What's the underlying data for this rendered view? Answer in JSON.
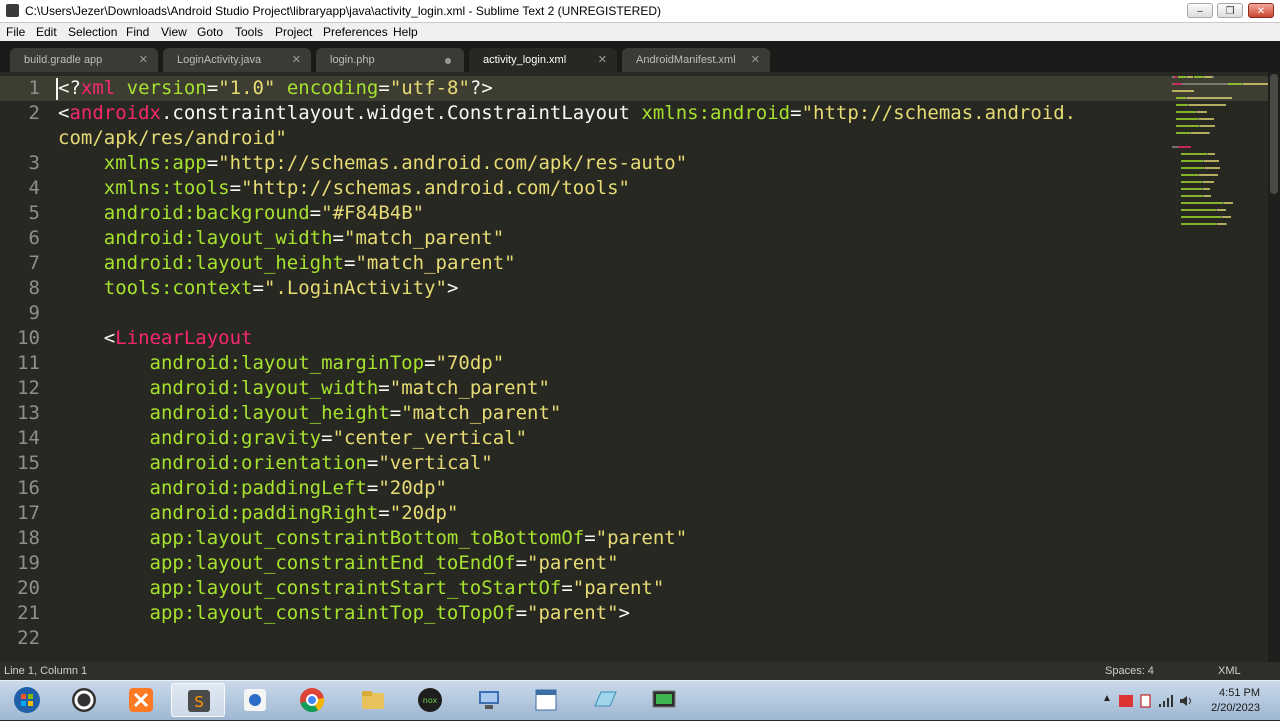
{
  "window": {
    "title": "C:\\Users\\Jezer\\Downloads\\Android Studio Project\\libraryapp\\java\\activity_login.xml - Sublime Text 2 (UNREGISTERED)",
    "controls": {
      "minimize": "–",
      "maximize": "❐",
      "close": "✕"
    }
  },
  "menu": [
    "File",
    "Edit",
    "Selection",
    "Find",
    "View",
    "Goto",
    "Tools",
    "Project",
    "Preferences",
    "Help"
  ],
  "tabs": [
    {
      "label": "build.gradle app",
      "state": "close"
    },
    {
      "label": "LoginActivity.java",
      "state": "close"
    },
    {
      "label": "login.php",
      "state": "modified"
    },
    {
      "label": "activity_login.xml",
      "state": "close",
      "active": true
    },
    {
      "label": "AndroidManifest.xml",
      "state": "close"
    }
  ],
  "code_lines": [
    {
      "n": "1",
      "tokens": [
        [
          "p",
          "<?"
        ],
        [
          "tag",
          "xml"
        ],
        [
          "p",
          " "
        ],
        [
          "attr",
          "version"
        ],
        [
          "p",
          "="
        ],
        [
          "str",
          "\"1.0\""
        ],
        [
          "p",
          " "
        ],
        [
          "attr",
          "encoding"
        ],
        [
          "p",
          "="
        ],
        [
          "str",
          "\"utf-8\""
        ],
        [
          "p",
          "?>"
        ]
      ]
    },
    {
      "n": "2",
      "tokens": [
        [
          "p",
          "<"
        ],
        [
          "tag",
          "androidx"
        ],
        [
          "p",
          ".constraintlayout.widget.ConstraintLayout "
        ],
        [
          "attr",
          "xmlns:android"
        ],
        [
          "p",
          "="
        ],
        [
          "str",
          "\"http://schemas.android."
        ]
      ]
    },
    {
      "n": "",
      "tokens": [
        [
          "str",
          "com/apk/res/android\""
        ]
      ]
    },
    {
      "n": "3",
      "tokens": [
        [
          "p",
          "    "
        ],
        [
          "attr",
          "xmlns:app"
        ],
        [
          "p",
          "="
        ],
        [
          "str",
          "\"http://schemas.android.com/apk/res-auto\""
        ]
      ]
    },
    {
      "n": "4",
      "tokens": [
        [
          "p",
          "    "
        ],
        [
          "attr",
          "xmlns:tools"
        ],
        [
          "p",
          "="
        ],
        [
          "str",
          "\"http://schemas.android.com/tools\""
        ]
      ]
    },
    {
      "n": "5",
      "tokens": [
        [
          "p",
          "    "
        ],
        [
          "attr",
          "android:background"
        ],
        [
          "p",
          "="
        ],
        [
          "str",
          "\"#F84B4B\""
        ]
      ]
    },
    {
      "n": "6",
      "tokens": [
        [
          "p",
          "    "
        ],
        [
          "attr",
          "android:layout_width"
        ],
        [
          "p",
          "="
        ],
        [
          "str",
          "\"match_parent\""
        ]
      ]
    },
    {
      "n": "7",
      "tokens": [
        [
          "p",
          "    "
        ],
        [
          "attr",
          "android:layout_height"
        ],
        [
          "p",
          "="
        ],
        [
          "str",
          "\"match_parent\""
        ]
      ]
    },
    {
      "n": "8",
      "tokens": [
        [
          "p",
          "    "
        ],
        [
          "attr",
          "tools:context"
        ],
        [
          "p",
          "="
        ],
        [
          "str",
          "\".LoginActivity\""
        ],
        [
          "p",
          ">"
        ]
      ]
    },
    {
      "n": "9",
      "tokens": []
    },
    {
      "n": "10",
      "tokens": [
        [
          "p",
          "    <"
        ],
        [
          "tag",
          "LinearLayout"
        ]
      ]
    },
    {
      "n": "11",
      "tokens": [
        [
          "p",
          "        "
        ],
        [
          "attr",
          "android:layout_marginTop"
        ],
        [
          "p",
          "="
        ],
        [
          "str",
          "\"70dp\""
        ]
      ]
    },
    {
      "n": "12",
      "tokens": [
        [
          "p",
          "        "
        ],
        [
          "attr",
          "android:layout_width"
        ],
        [
          "p",
          "="
        ],
        [
          "str",
          "\"match_parent\""
        ]
      ]
    },
    {
      "n": "13",
      "tokens": [
        [
          "p",
          "        "
        ],
        [
          "attr",
          "android:layout_height"
        ],
        [
          "p",
          "="
        ],
        [
          "str",
          "\"match_parent\""
        ]
      ]
    },
    {
      "n": "14",
      "tokens": [
        [
          "p",
          "        "
        ],
        [
          "attr",
          "android:gravity"
        ],
        [
          "p",
          "="
        ],
        [
          "str",
          "\"center_vertical\""
        ]
      ]
    },
    {
      "n": "15",
      "tokens": [
        [
          "p",
          "        "
        ],
        [
          "attr",
          "android:orientation"
        ],
        [
          "p",
          "="
        ],
        [
          "str",
          "\"vertical\""
        ]
      ]
    },
    {
      "n": "16",
      "tokens": [
        [
          "p",
          "        "
        ],
        [
          "attr",
          "android:paddingLeft"
        ],
        [
          "p",
          "="
        ],
        [
          "str",
          "\"20dp\""
        ]
      ]
    },
    {
      "n": "17",
      "tokens": [
        [
          "p",
          "        "
        ],
        [
          "attr",
          "android:paddingRight"
        ],
        [
          "p",
          "="
        ],
        [
          "str",
          "\"20dp\""
        ]
      ]
    },
    {
      "n": "18",
      "tokens": [
        [
          "p",
          "        "
        ],
        [
          "attr",
          "app:layout_constraintBottom_toBottomOf"
        ],
        [
          "p",
          "="
        ],
        [
          "str",
          "\"parent\""
        ]
      ]
    },
    {
      "n": "19",
      "tokens": [
        [
          "p",
          "        "
        ],
        [
          "attr",
          "app:layout_constraintEnd_toEndOf"
        ],
        [
          "p",
          "="
        ],
        [
          "str",
          "\"parent\""
        ]
      ]
    },
    {
      "n": "20",
      "tokens": [
        [
          "p",
          "        "
        ],
        [
          "attr",
          "app:layout_constraintStart_toStartOf"
        ],
        [
          "p",
          "="
        ],
        [
          "str",
          "\"parent\""
        ]
      ]
    },
    {
      "n": "21",
      "tokens": [
        [
          "p",
          "        "
        ],
        [
          "attr",
          "app:layout_constraintTop_toTopOf"
        ],
        [
          "p",
          "="
        ],
        [
          "str",
          "\"parent\""
        ],
        [
          "p",
          ">"
        ]
      ]
    },
    {
      "n": "22",
      "tokens": []
    }
  ],
  "status": {
    "position": "Line 1, Column 1",
    "indent": "Spaces: 4",
    "syntax": "XML"
  },
  "taskbar": {
    "apps": [
      "start-orb-icon",
      "ccleaner-icon",
      "xampp-icon",
      "sublime-text-icon",
      "paint-icon",
      "chrome-icon",
      "folder-icon",
      "nox-icon",
      "network-icon",
      "notepad-window-icon",
      "monitor-icon",
      "screen-recorder-icon"
    ],
    "active_app": "sublime-text-icon",
    "clock_time": "4:51 PM",
    "clock_date": "2/20/2023"
  },
  "colors": {
    "editor_bg": "#272822",
    "tag": "#f92672",
    "attribute": "#a6e22e",
    "string": "#e6db74",
    "plain": "#f8f8f2"
  }
}
